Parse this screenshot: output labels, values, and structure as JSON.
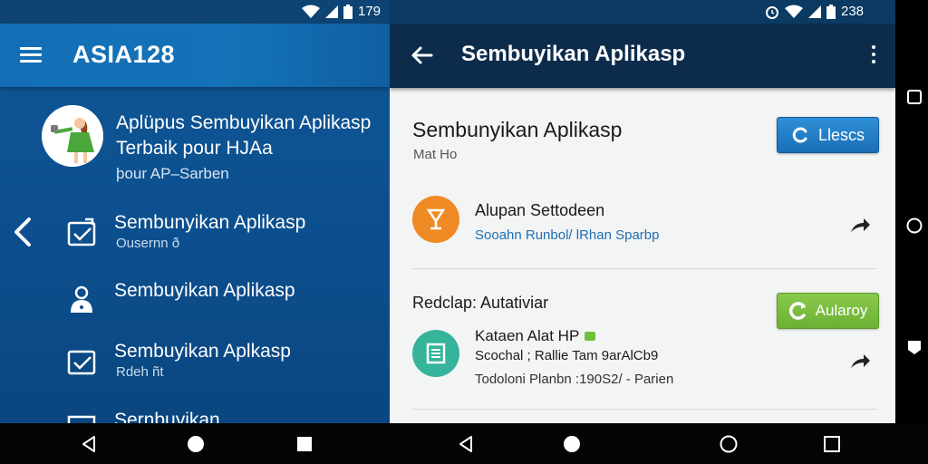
{
  "status_left": {
    "time": "179"
  },
  "status_right": {
    "time": "238"
  },
  "left_app": {
    "brand": "ASIA128",
    "profile": {
      "title_line1": "Aplüpus Sembuyikan Aplikasp",
      "title_line2": "Terbaik pour HJAa",
      "subtitle": "þour AP–Sarben"
    },
    "nav": [
      {
        "label": "Sembunyikan Aplikasp",
        "sub": "Ousernn ð",
        "icon": "box-check-icon"
      },
      {
        "label": "Sembuyikan Aplikasp",
        "sub": "",
        "icon": "person-icon"
      },
      {
        "label": "Sembuyikan Aplkasp",
        "sub": "Rdeh ñt",
        "icon": "box-check-icon"
      },
      {
        "label": "Sernbuyikan",
        "sub": "",
        "icon": "grid-icon"
      }
    ]
  },
  "right_app": {
    "title": "Sembuyikan Aplikasp",
    "card": {
      "title": "Sembunyikan Aplikasp",
      "subtitle": "Mat Ho",
      "button": "Llescs"
    },
    "item1": {
      "title": "Alupan Settodeen",
      "subtitle": "Sooahn Runbol/ lRhan Sparbp"
    },
    "section_label": "Redclap: Autativiar",
    "item2": {
      "title": "Kataen Alat HP",
      "subtitle": "Scochal ; Rallie Tam 9arAlCb9",
      "meta": "Todoloni Planbn :190S2/ - Parien",
      "button": "Aularoy"
    }
  },
  "colors": {
    "left_bg": "#0c4f8e",
    "right_appbar": "#0d2c4c",
    "accent_blue": "#1b6fb7",
    "accent_green": "#6cb134",
    "orange": "#f08a24",
    "teal": "#35b39b"
  }
}
